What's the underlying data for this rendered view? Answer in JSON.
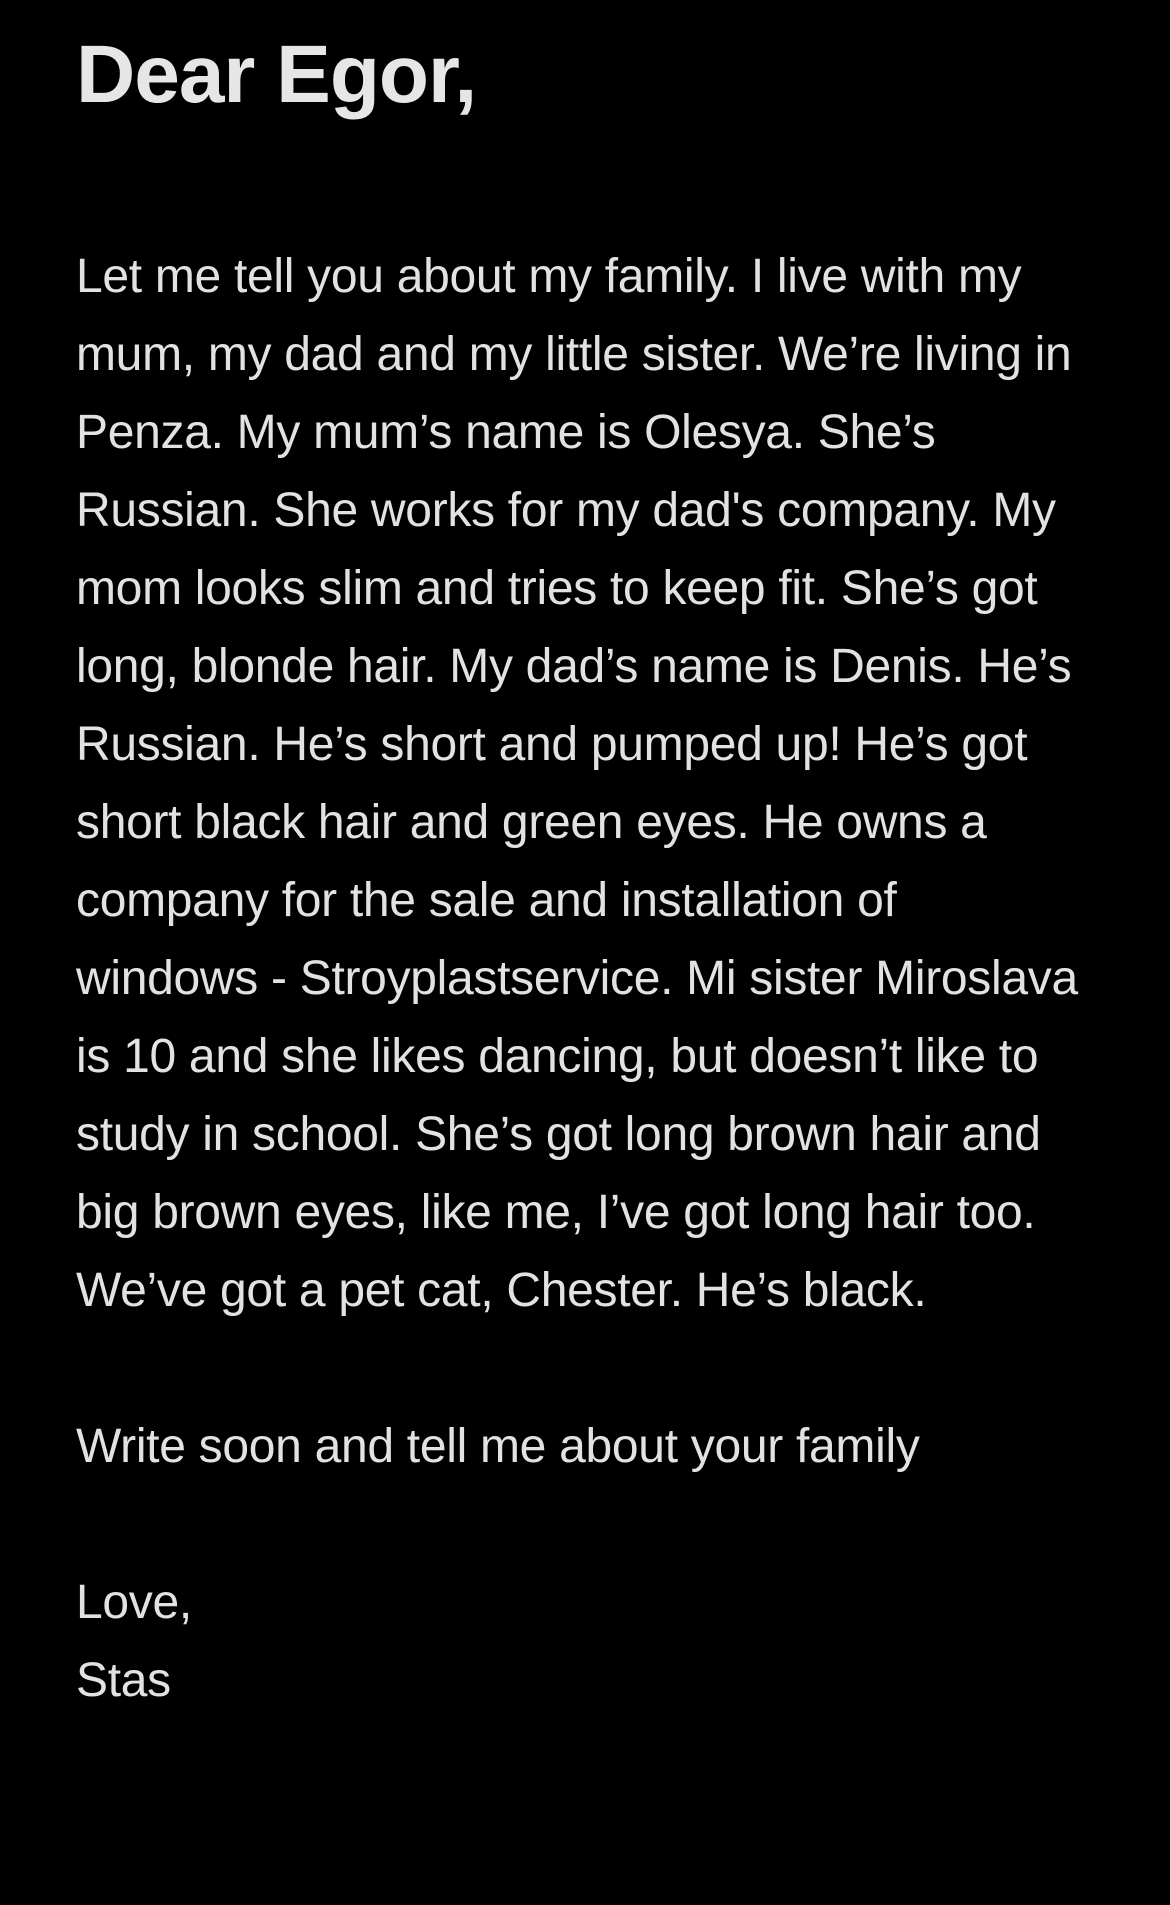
{
  "note": {
    "greeting": "Dear Egor,",
    "body": "Let me tell you about my family. I live with my mum, my dad and my little sister. We’re living in Penza. My mum’s name is Olesya. She’s Russian. She works for my dad's company. My mom looks slim and tries to keep fit. She’s got long, blonde hair. My dad’s name is Denis. He’s Russian. He’s short and pumped up! He’s got short black hair and green eyes. He owns a company for the sale and installation of windows - Stroyplastservice. Mi sister Miroslava is 10 and she likes dancing, but doesn’t like to study in school. She’s got long brown hair and big brown eyes, like me, I’ve got long hair too. We’ve got a pet cat, Chester. He’s black.",
    "closing": "Write soon and tell me about your family",
    "signoff": "Love,",
    "signature": "Stas"
  },
  "colors": {
    "background": "#000000",
    "text": "#e4e4e4"
  }
}
